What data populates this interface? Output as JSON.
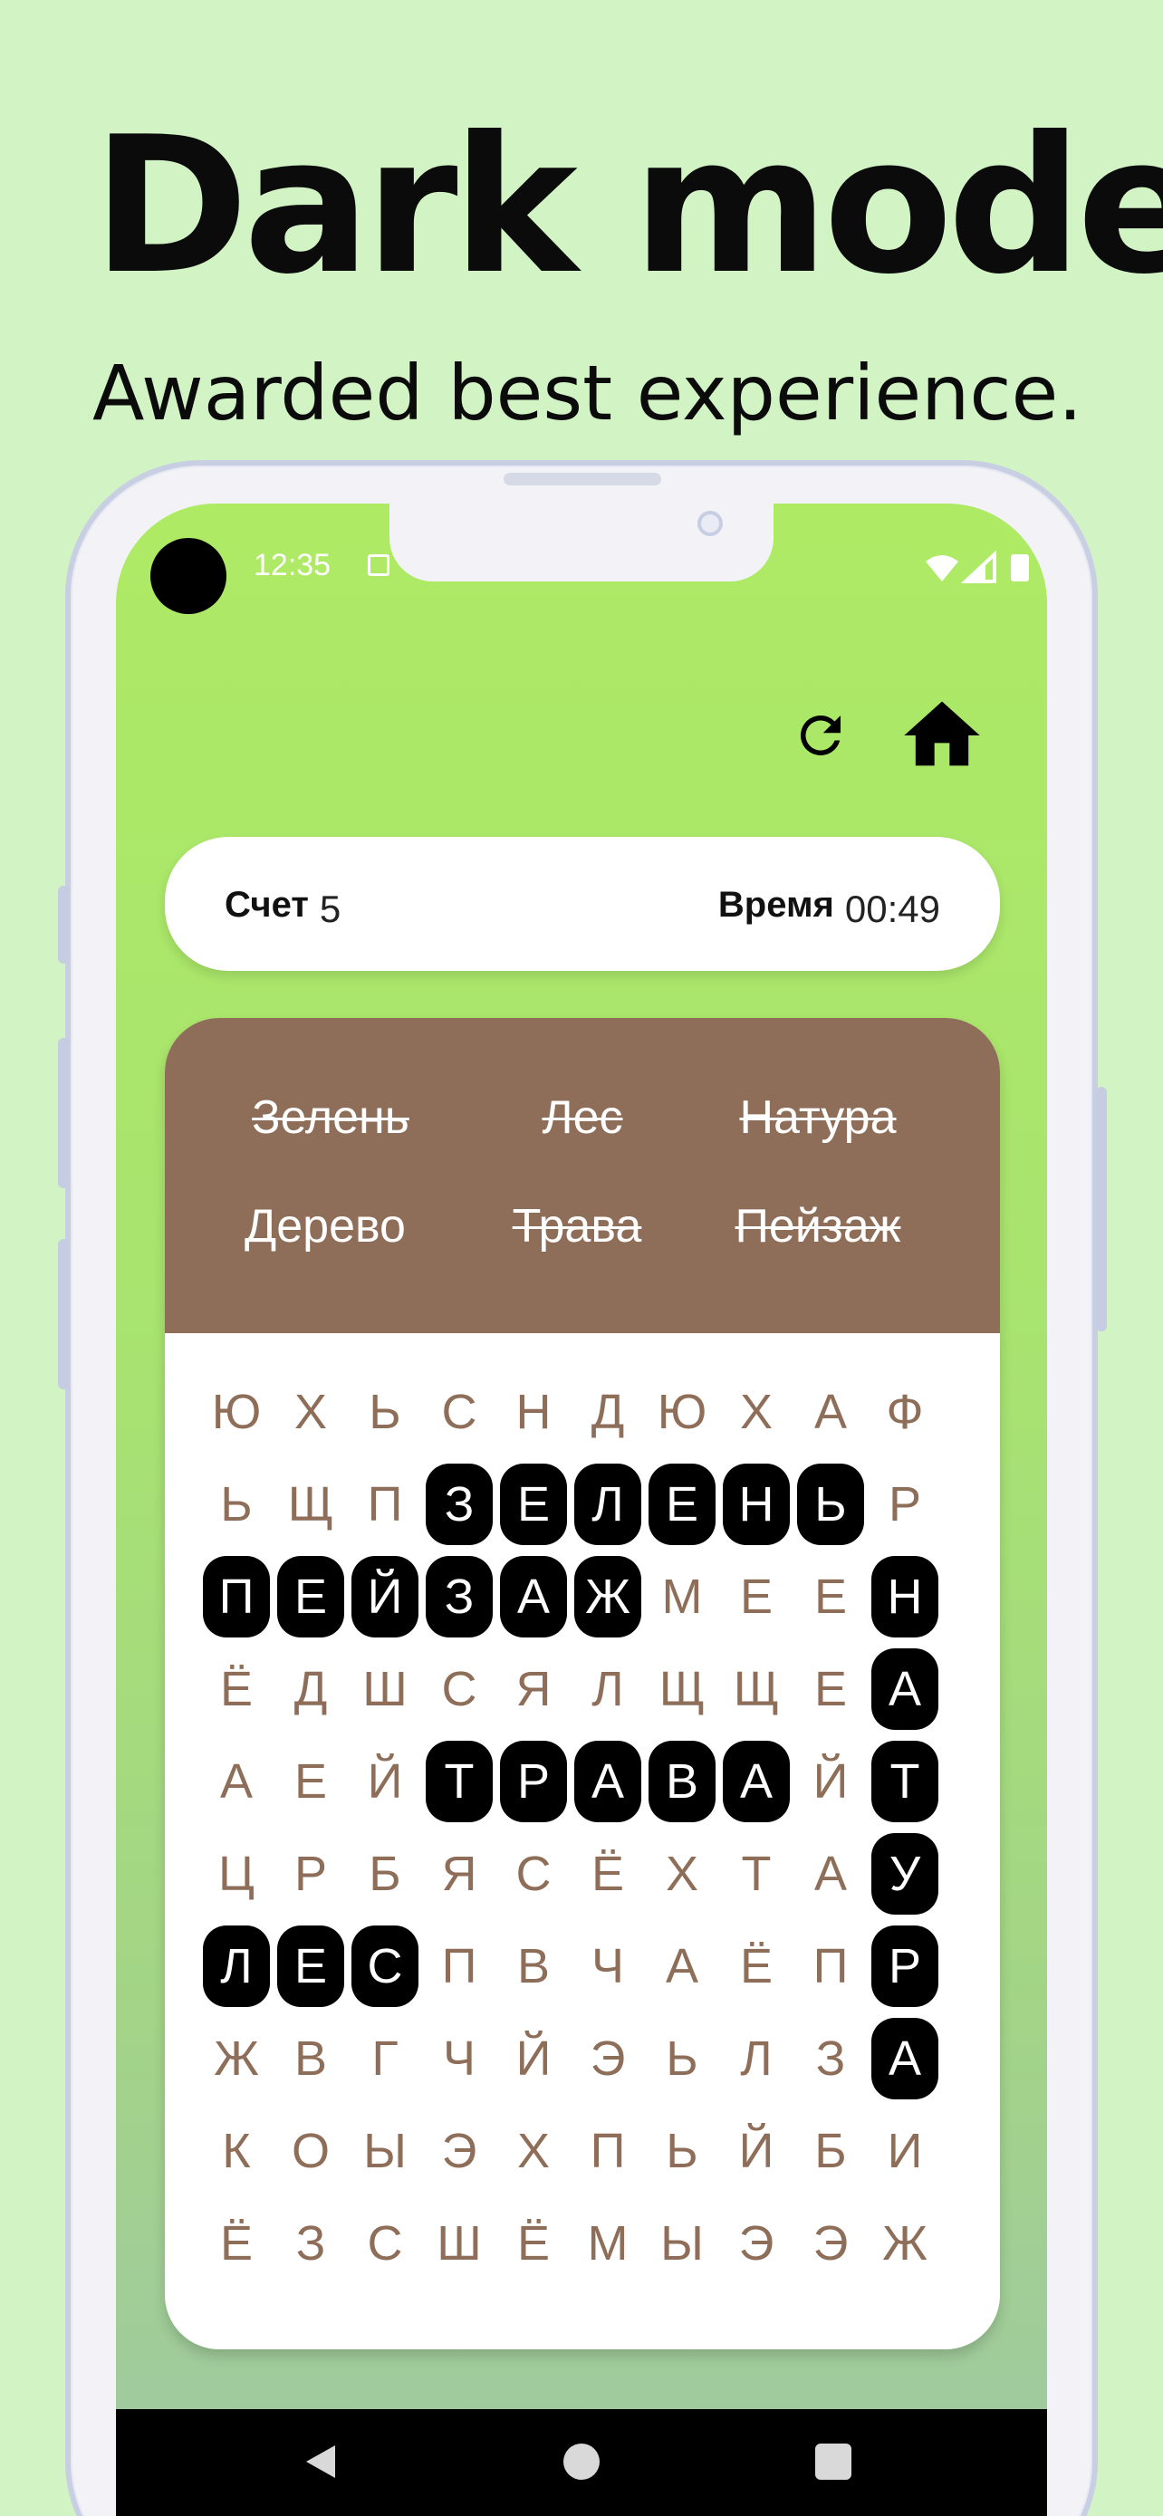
{
  "promo": {
    "headline": "Dark mode",
    "subhead": "Awarded best experience."
  },
  "status_bar": {
    "time": "12:35"
  },
  "toolbar": {
    "icons": [
      "refresh-icon",
      "home-icon"
    ]
  },
  "score_bar": {
    "score_label": "Счет",
    "score_value": "5",
    "time_label": "Время",
    "time_value": "00:49"
  },
  "words": [
    {
      "text": "Зелень",
      "found": true
    },
    {
      "text": "Лес",
      "found": true
    },
    {
      "text": "Натура",
      "found": true
    },
    {
      "text": "Дерево",
      "found": false
    },
    {
      "text": "Трава",
      "found": true
    },
    {
      "text": "Пейзаж",
      "found": true
    }
  ],
  "grid": {
    "rows": [
      [
        "Ю",
        "Х",
        "Ь",
        "С",
        "Н",
        "Д",
        "Ю",
        "Х",
        "А",
        "Ф"
      ],
      [
        "Ь",
        "Щ",
        "П",
        "З",
        "Е",
        "Л",
        "Е",
        "Н",
        "Ь",
        "Р"
      ],
      [
        "П",
        "Е",
        "Й",
        "З",
        "А",
        "Ж",
        "М",
        "Е",
        "Е",
        "Н"
      ],
      [
        "Ё",
        "Д",
        "Ш",
        "С",
        "Я",
        "Л",
        "Щ",
        "Щ",
        "Е",
        "А"
      ],
      [
        "А",
        "Е",
        "Й",
        "Т",
        "Р",
        "А",
        "В",
        "А",
        "Й",
        "Т"
      ],
      [
        "Ц",
        "Р",
        "Б",
        "Я",
        "С",
        "Ё",
        "Х",
        "Т",
        "А",
        "У"
      ],
      [
        "Л",
        "Е",
        "С",
        "П",
        "В",
        "Ч",
        "А",
        "Ё",
        "П",
        "Р"
      ],
      [
        "Ж",
        "В",
        "Г",
        "Ч",
        "Й",
        "Э",
        "Ь",
        "Л",
        "З",
        "А"
      ],
      [
        "К",
        "О",
        "Ы",
        "Э",
        "Х",
        "П",
        "Ь",
        "Й",
        "Б",
        "И"
      ],
      [
        "Ё",
        "З",
        "С",
        "Ш",
        "Ё",
        "М",
        "Ы",
        "Э",
        "Э",
        "Ж"
      ]
    ],
    "selected": [
      [
        1,
        3
      ],
      [
        1,
        4
      ],
      [
        1,
        5
      ],
      [
        1,
        6
      ],
      [
        1,
        7
      ],
      [
        1,
        8
      ],
      [
        2,
        0
      ],
      [
        2,
        1
      ],
      [
        2,
        2
      ],
      [
        2,
        3
      ],
      [
        2,
        4
      ],
      [
        2,
        5
      ],
      [
        2,
        9
      ],
      [
        3,
        9
      ],
      [
        4,
        9
      ],
      [
        5,
        9
      ],
      [
        6,
        9
      ],
      [
        7,
        9
      ],
      [
        4,
        3
      ],
      [
        4,
        4
      ],
      [
        4,
        5
      ],
      [
        4,
        6
      ],
      [
        4,
        7
      ],
      [
        6,
        0
      ],
      [
        6,
        1
      ],
      [
        6,
        2
      ]
    ]
  },
  "colors": {
    "background": "#d2f3c4",
    "screen_top": "#aeea64",
    "word_panel": "#8e6e59",
    "letter": "#8e6e59",
    "selected_cell": "#000000"
  }
}
